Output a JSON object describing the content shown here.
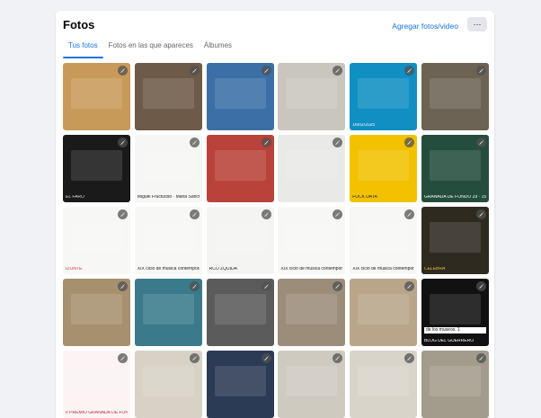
{
  "header": {
    "title": "Fotos",
    "add_label": "Agregar fotos/video",
    "more_label": "···"
  },
  "tabs": [
    {
      "label": "Tus fotos",
      "active": true
    },
    {
      "label": "Fotos en las que apareces",
      "active": false
    },
    {
      "label": "Álbumes",
      "active": false
    }
  ],
  "photos": [
    {
      "caption": "",
      "bg": "#c89a5a",
      "fg": "#2a2a2a"
    },
    {
      "caption": "",
      "bg": "#6e5a48",
      "fg": "#f2e8da"
    },
    {
      "caption": "",
      "bg": "#3b6fa6",
      "fg": "#ffffff"
    },
    {
      "caption": "",
      "bg": "#c9c6bd",
      "fg": "#333333"
    },
    {
      "caption": "16/02/2025",
      "bg": "#0f8fc2",
      "fg": "#ffffff"
    },
    {
      "caption": "",
      "bg": "#6d6355",
      "fg": "#ffffff"
    },
    {
      "caption": "EL FARO",
      "bg": "#1a1a1a",
      "fg": "#dddddd"
    },
    {
      "caption": "Miguel Fructuoso · Maria Sánchez · Miguel Ángel Tornero",
      "bg": "#f6f6f4",
      "fg": "#222222"
    },
    {
      "caption": "",
      "bg": "#b9423a",
      "fg": "#ffffff"
    },
    {
      "caption": "",
      "bg": "#e9e9e7",
      "fg": "#222222"
    },
    {
      "caption": "FUCK DATA",
      "bg": "#f2c200",
      "fg": "#222222"
    },
    {
      "caption": "GRANADA DE FONDO 29 · 15",
      "bg": "#244d3d",
      "fg": "#ffffff"
    },
    {
      "caption": "IZONTE",
      "bg": "#f7f7f5",
      "fg": "#c0392b"
    },
    {
      "caption": "XIX ciclo de música contemporánea",
      "bg": "#f7f7f5",
      "fg": "#222222"
    },
    {
      "caption": "RCO ZQUIDA",
      "bg": "#f4f4f2",
      "fg": "#222222"
    },
    {
      "caption": "XIX ciclo de música contemporánea",
      "bg": "#f7f7f5",
      "fg": "#222222"
    },
    {
      "caption": "XIX ciclo de música contemporánea",
      "bg": "#f7f7f5",
      "fg": "#222222"
    },
    {
      "caption": "CELEBRA",
      "bg": "#2f2a1f",
      "fg": "#e3c23b"
    },
    {
      "caption": "",
      "bg": "#a7906e",
      "fg": "#ffffff"
    },
    {
      "caption": "",
      "bg": "#3a7a8a",
      "fg": "#ffffff"
    },
    {
      "caption": "",
      "bg": "#5b5b5b",
      "fg": "#ffffff"
    },
    {
      "caption": "",
      "bg": "#9c8d7a",
      "fg": "#ffffff"
    },
    {
      "caption": "",
      "bg": "#b9a58a",
      "fg": "#ffffff"
    },
    {
      "caption": "BLOG DEL GUERRERO",
      "bg": "#111111",
      "fg": "#ffffff"
    },
    {
      "caption": "II PREMIO GRANADA DE FONDO",
      "bg": "#fbf3f4",
      "fg": "#b03048"
    },
    {
      "caption": "",
      "bg": "#d8d2c6",
      "fg": "#333333"
    },
    {
      "caption": "",
      "bg": "#2b3a55",
      "fg": "#ffffff"
    },
    {
      "caption": "",
      "bg": "#cfcac0",
      "fg": "#333333"
    },
    {
      "caption": "",
      "bg": "#d9d4ca",
      "fg": "#333333"
    },
    {
      "caption": "",
      "bg": "#a39c8c",
      "fg": "#ffffff"
    }
  ],
  "photo_extra": {
    "row4_col6_sub": "de los museos. 1"
  },
  "icons": {
    "edit": "pencil-icon"
  },
  "colors": {
    "accent": "#1b74e4",
    "page_bg": "#f0f2f5",
    "card_bg": "#ffffff"
  }
}
